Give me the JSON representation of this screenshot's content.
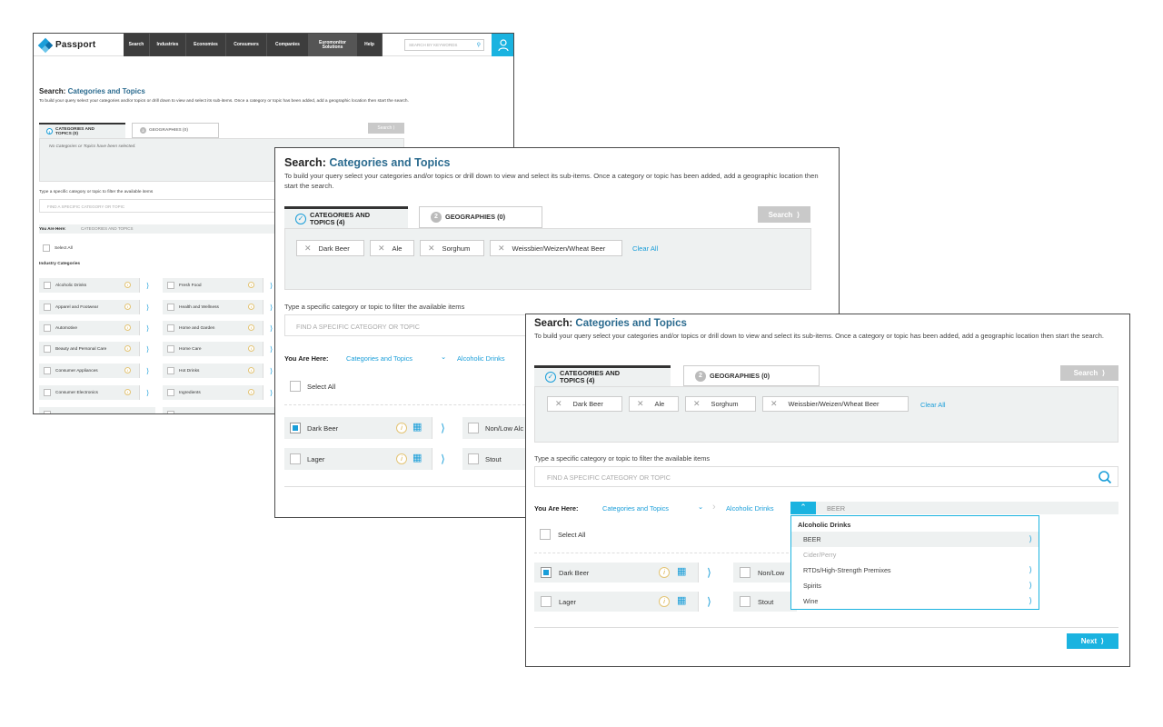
{
  "shot1": {
    "logo": "Passport",
    "nav": [
      "Search",
      "Industries",
      "Economies",
      "Consumers",
      "Companies",
      "Euromonitor Solutions",
      "Help"
    ],
    "search_placeholder": "SEARCH BY KEYWORDS",
    "title_prefix": "Search:",
    "title_main": "Categories and Topics",
    "description": "To build your query select your categories and/or topics or drill down to view and select its sub-items. Once a category or topic has been added, add a geographic location then start the search.",
    "tab1": "CATEGORIES AND TOPICS (0)",
    "tab1_num": "1",
    "tab2": "GEOGRAPHIES (0)",
    "tab2_num": "2",
    "search_btn": "Search",
    "empty_text": "No Categories or Topics have been selected.",
    "filter_label": "Type a specific category or topic to filter the available items",
    "filter_placeholder": "FIND A SPECIFIC CATEGORY OR TOPIC",
    "you_are_here": "You Are Here:",
    "crumb": "CATEGORIES AND TOPICS",
    "select_all": "Select All",
    "industry_categories": "Industry Categories",
    "col1": [
      "Alcoholic Drinks",
      "Apparel and Footwear",
      "Automotive",
      "Beauty and Personal Care",
      "Consumer Appliances",
      "Consumer Electronics"
    ],
    "col2": [
      "Fresh Food",
      "Health and Wellness",
      "Home and Garden",
      "Home Care",
      "Hot Drinks",
      "Ingredients"
    ]
  },
  "shot2": {
    "title_prefix": "Search:",
    "title_main": "Categories and Topics",
    "description": "To build your query select your categories and/or topics or drill down to view and select its sub-items. Once a category or topic has been added, add a geographic location then start the search.",
    "tab1": "CATEGORIES AND TOPICS (4)",
    "tab2": "GEOGRAPHIES (0)",
    "tab2_num": "2",
    "search_btn": "Search",
    "chips": [
      "Dark Beer",
      "Ale",
      "Sorghum",
      "Weissbier/Weizen/Wheat Beer"
    ],
    "clear_all": "Clear All",
    "filter_label": "Type a specific category or topic to filter the available items",
    "filter_placeholder": "FIND A SPECIFIC CATEGORY OR TOPIC",
    "you_are_here": "You Are Here:",
    "crumb1": "Categories and Topics",
    "crumb2": "Alcoholic Drinks",
    "select_all": "Select All",
    "items": [
      "Dark Beer",
      "Lager"
    ],
    "items_right": [
      "Non/Low Alc",
      "Stout"
    ]
  },
  "shot3": {
    "title_prefix": "Search:",
    "title_main": "Categories and Topics",
    "description": "To build your query select your categories and/or topics or drill down to view and select its sub-items. Once a category or topic has been added, add a geographic location then start the search.",
    "tab1": "CATEGORIES AND TOPICS (4)",
    "tab2": "GEOGRAPHIES (0)",
    "tab2_num": "2",
    "search_btn": "Search",
    "chips": [
      "Dark Beer",
      "Ale",
      "Sorghum",
      "Weissbier/Weizen/Wheat Beer"
    ],
    "clear_all": "Clear All",
    "filter_label": "Type a specific category or topic to filter the available items",
    "filter_placeholder": "FIND A SPECIFIC CATEGORY OR TOPIC",
    "you_are_here": "You Are Here:",
    "crumb1": "Categories and Topics",
    "crumb2": "Alcoholic Drinks",
    "crumb3": "BEER",
    "select_all": "Select All",
    "items": [
      "Dark Beer",
      "Lager"
    ],
    "items_right": [
      "Non/Low",
      "Stout"
    ],
    "dropdown": {
      "heading": "Alcoholic Drinks",
      "options": [
        "BEER",
        "Cider/Perry",
        "RTDs/High-Strength Premixes",
        "Spirits",
        "Wine"
      ]
    },
    "next_btn": "Next"
  },
  "colors": {
    "accent": "#1ab3e0",
    "title_blue": "#2b6b8f",
    "panel": "#eef1f1",
    "nav_dark": "#3d3d3d"
  }
}
